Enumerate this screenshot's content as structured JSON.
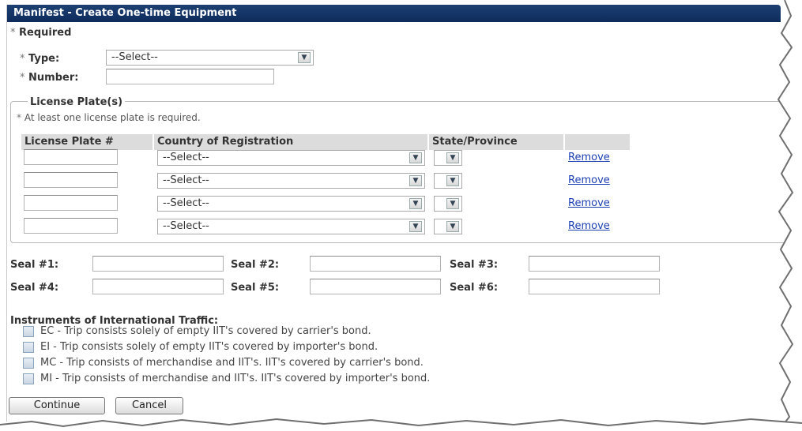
{
  "window": {
    "title": "Manifest - Create One-time Equipment"
  },
  "required_note": "Required",
  "form": {
    "type_label": "Type:",
    "type_value": "--Select--",
    "number_label": "Number:",
    "number_value": ""
  },
  "plates": {
    "legend": "License Plate(s)",
    "note": "At least one license plate is required.",
    "headers": [
      "License Plate #",
      "Country of Registration",
      "State/Province",
      ""
    ],
    "rows": [
      {
        "plate": "",
        "country": "--Select--",
        "state": "",
        "remove": "Remove"
      },
      {
        "plate": "",
        "country": "--Select--",
        "state": "",
        "remove": "Remove"
      },
      {
        "plate": "",
        "country": "--Select--",
        "state": "",
        "remove": "Remove"
      },
      {
        "plate": "",
        "country": "--Select--",
        "state": "",
        "remove": "Remove"
      }
    ]
  },
  "seals": [
    {
      "label": "Seal #1:",
      "value": ""
    },
    {
      "label": "Seal #2:",
      "value": ""
    },
    {
      "label": "Seal #3:",
      "value": ""
    },
    {
      "label": "Seal #4:",
      "value": ""
    },
    {
      "label": "Seal #5:",
      "value": ""
    },
    {
      "label": "Seal #6:",
      "value": ""
    }
  ],
  "iit": {
    "title": "Instruments of International Traffic:",
    "options": [
      {
        "label": "EC - Trip consists solely of empty IIT's covered by carrier's bond.",
        "checked": false
      },
      {
        "label": "EI - Trip consists solely of empty IIT's covered by importer's bond.",
        "checked": false
      },
      {
        "label": "MC - Trip consists of merchandise and IIT's. IIT's covered by carrier's bond.",
        "checked": false
      },
      {
        "label": "MI - Trip consists of merchandise and IIT's. IIT's covered by importer's bond.",
        "checked": false
      }
    ]
  },
  "buttons": {
    "continue": "Continue",
    "cancel": "Cancel"
  },
  "colors": {
    "titlebar": "#0d2c5c",
    "link": "#1b3fb4",
    "header_bg": "#dcdcdc"
  }
}
